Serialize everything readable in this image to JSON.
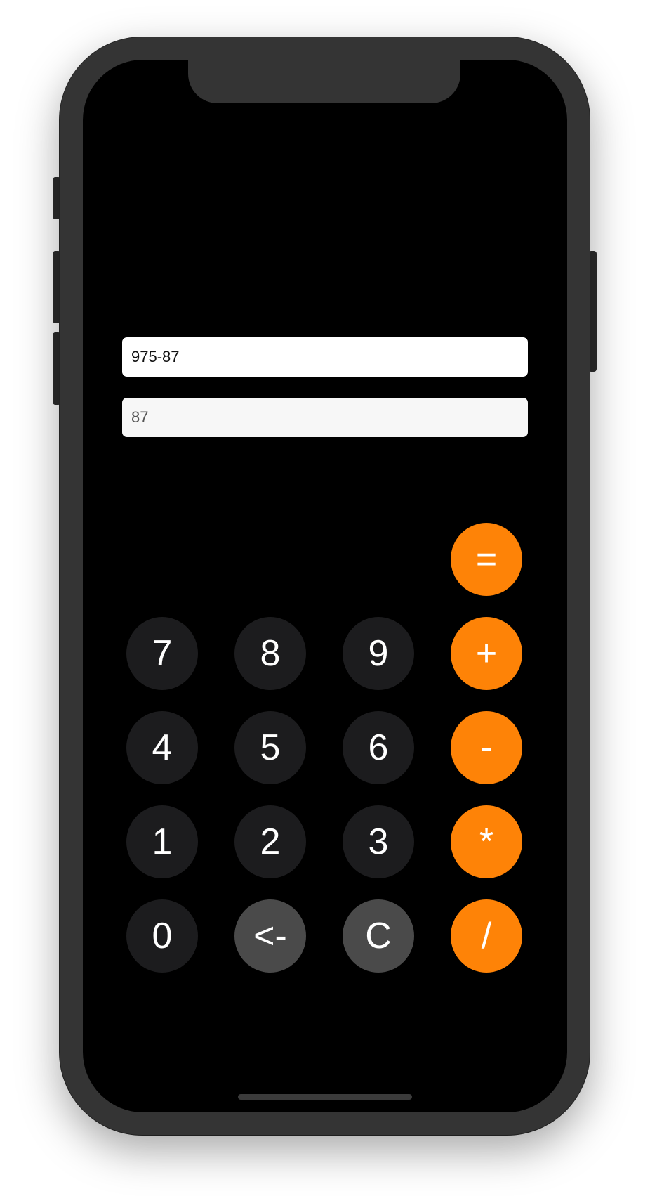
{
  "display": {
    "expression": "975-87",
    "result": "87"
  },
  "keypad": {
    "equals": "=",
    "plus": "+",
    "minus": "-",
    "multiply": "*",
    "divide": "/",
    "seven": "7",
    "eight": "8",
    "nine": "9",
    "four": "4",
    "five": "5",
    "six": "6",
    "one": "1",
    "two": "2",
    "three": "3",
    "zero": "0",
    "backspace": "<-",
    "clear": "C"
  },
  "colors": {
    "operator": "#fe8307",
    "digit": "#1c1c1e",
    "utility": "#4a4a4a",
    "screen_background": "#000000",
    "device_frame": "#343434"
  }
}
